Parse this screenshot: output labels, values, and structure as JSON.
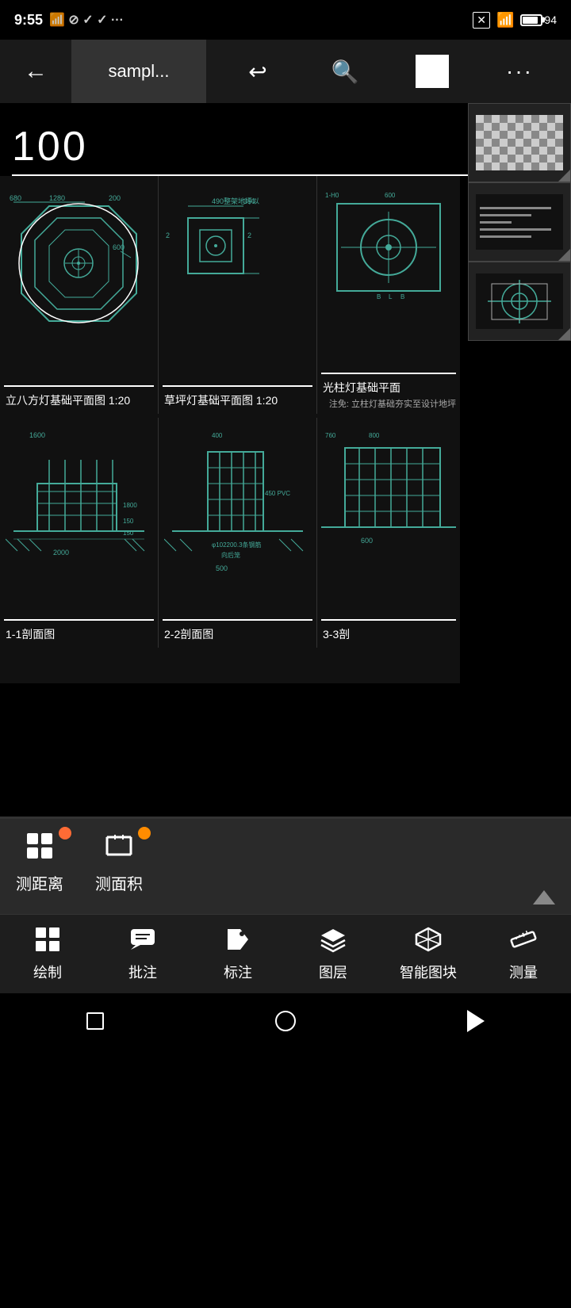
{
  "statusBar": {
    "time": "9:55",
    "battery": "94"
  },
  "toolbar": {
    "backLabel": "←",
    "titleLabel": "sampl...",
    "undoLabel": "↩",
    "searchLabel": "🔍",
    "moreLabel": "···"
  },
  "scale": {
    "value": "100"
  },
  "drawings": {
    "row1": [
      {
        "id": "draw-1",
        "title": "立八方灯基础平面图 1:20",
        "type": "octagon"
      },
      {
        "id": "draw-2",
        "title": "草坪灯基础平面图 1:20",
        "type": "lamp"
      },
      {
        "id": "draw-3",
        "title": "光柱灯基础平面",
        "sublabel": "注免: 立柱灯基础夯实处理至设计地坪",
        "type": "circle-plan"
      }
    ],
    "row2": [
      {
        "id": "section-1",
        "title": "1-1剖面图",
        "type": "section1"
      },
      {
        "id": "section-2",
        "title": "2-2剖面图",
        "type": "section2"
      },
      {
        "id": "section-3",
        "title": "3-3剖",
        "type": "section3"
      }
    ]
  },
  "toolPanel": {
    "items": [
      {
        "id": "measure-distance",
        "label": "测距离",
        "icon": "ruler-distance"
      },
      {
        "id": "measure-area",
        "label": "测面积",
        "icon": "ruler-area"
      }
    ]
  },
  "bottomNav": {
    "items": [
      {
        "id": "draw",
        "label": "绘制",
        "icon": "draw-icon"
      },
      {
        "id": "annotate",
        "label": "批注",
        "icon": "chat-icon"
      },
      {
        "id": "label",
        "label": "标注",
        "icon": "tag-icon"
      },
      {
        "id": "layer",
        "label": "图层",
        "icon": "layers-icon"
      },
      {
        "id": "smartblock",
        "label": "智能图块",
        "icon": "box3d-icon"
      },
      {
        "id": "measure",
        "label": "测量",
        "icon": "measure-icon"
      }
    ]
  },
  "sysNav": {
    "squareLabel": "□",
    "circleLabel": "○",
    "triangleLabel": "◁"
  }
}
